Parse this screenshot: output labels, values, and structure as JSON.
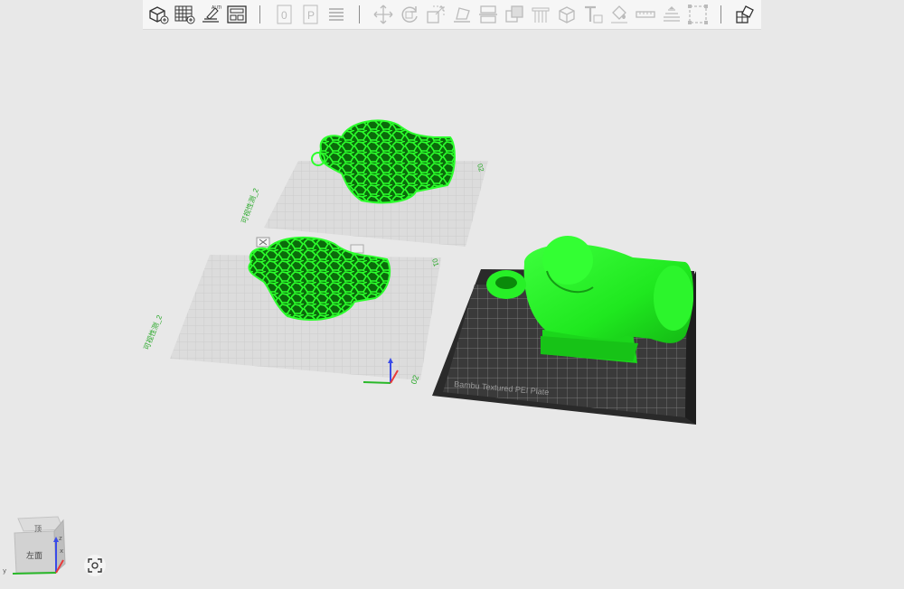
{
  "toolbar": {
    "groups": [
      [
        "add-object-icon",
        "add-plate-icon",
        "auto-orient-icon",
        "arrange-icon"
      ],
      [
        "plate-number-0-icon",
        "plate-p-icon",
        "layers-list-icon"
      ],
      [
        "move-icon",
        "rotate-icon",
        "scale-icon",
        "lay-on-face-icon",
        "cut-icon",
        "boolean-icon",
        "support-paint-icon",
        "assembly-icon",
        "text-emboss-icon",
        "color-paint-icon",
        "measure-icon",
        "variable-layer-icon",
        "seam-icon"
      ],
      [
        "split-icon"
      ]
    ]
  },
  "scene": {
    "plates": [
      {
        "label": "02",
        "name": "可视性测_2",
        "state": "inactive"
      },
      {
        "label": "01",
        "name": "可视性测_2",
        "state": "inactive"
      },
      {
        "label": "Bambu Textured PEI Plate",
        "state": "active"
      }
    ],
    "model_color": "#1fe81f",
    "plate_color": "#3a3a3a"
  },
  "viewcube": {
    "face_label": "左面",
    "top_label": "顶",
    "axis_x": "x",
    "axis_y": "y",
    "axis_z": "z"
  },
  "colors": {
    "accent": "#1fe81f",
    "background": "#e8e8e8",
    "toolbar": "#f6f6f6"
  }
}
